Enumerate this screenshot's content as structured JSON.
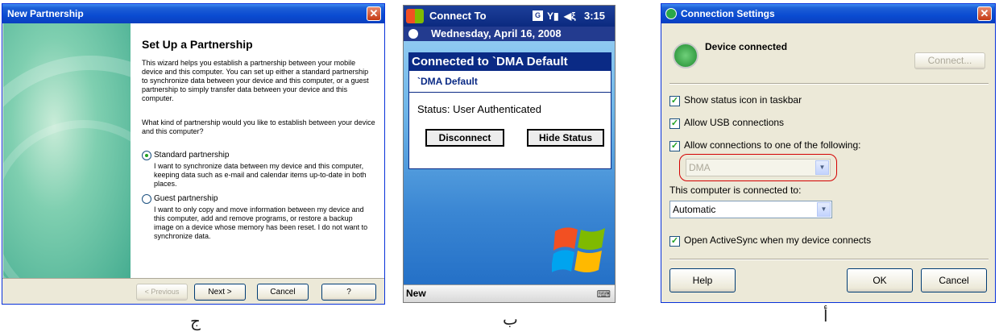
{
  "wizard": {
    "title": "New Partnership",
    "heading": "Set Up a Partnership",
    "intro": "This wizard helps you establish a partnership between your mobile device and this computer.  You can set up either a standard partnership to synchronize data between your device and this computer, or a guest partnership to simply transfer data between your device and this computer.",
    "question": "What kind of partnership would you like to establish between your device and this computer?",
    "option_standard": "Standard partnership",
    "option_standard_desc": "I want to synchronize data between my device and this computer, keeping data such as e-mail and calendar items up-to-date in both places.",
    "option_guest": "Guest partnership",
    "option_guest_desc": "I want to only copy and move information between my device and this computer, add and remove programs, or restore a backup image on a device whose memory has been reset. I do not want to synchronize data.",
    "btn_previous": "< Previous",
    "btn_next": "Next >",
    "btn_cancel": "Cancel",
    "btn_help": "?"
  },
  "ppc": {
    "app_title": "Connect To",
    "time": "3:15",
    "date": "Wednesday, April 16, 2008",
    "dialog_title": "Connected to `DMA Default",
    "dialog_sub": "`DMA Default",
    "status": "Status:  User Authenticated",
    "btn_disconnect": "Disconnect",
    "btn_hide": "Hide Status",
    "softkey_left": "New"
  },
  "conn": {
    "title": "Connection Settings",
    "device_status": "Device connected",
    "btn_connect": "Connect...",
    "cb_status_icon": "Show status icon in taskbar",
    "cb_usb": "Allow USB connections",
    "cb_connections": "Allow connections to one of the following:",
    "combo_dma": "DMA",
    "connected_to_label": "This computer is connected to:",
    "combo_automatic": "Automatic",
    "cb_open_activesync": "Open ActiveSync when my device connects",
    "btn_help": "Help",
    "btn_ok": "OK",
    "btn_cancel": "Cancel",
    "highlight_color": "#d40000"
  },
  "captions": {
    "left": "ج",
    "center": "ب",
    "right": "أ"
  }
}
